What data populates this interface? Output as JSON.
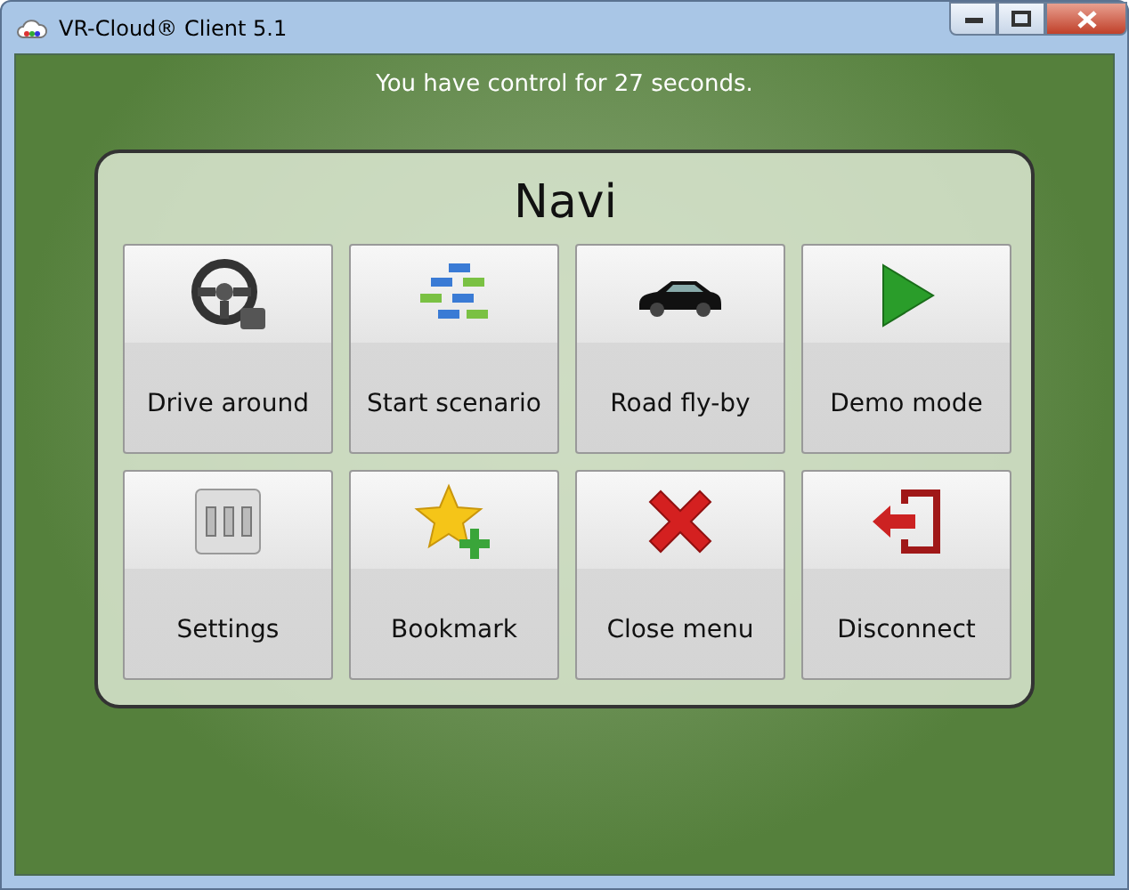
{
  "window": {
    "title": "VR-Cloud® Client 5.1"
  },
  "message": "You have control for 27 seconds.",
  "menu": {
    "title": "Navi",
    "items": [
      {
        "label": "Drive around",
        "kind": "wheel"
      },
      {
        "label": "Start scenario",
        "kind": "flow"
      },
      {
        "label": "Road fly-by",
        "kind": "car"
      },
      {
        "label": "Demo mode",
        "kind": "play"
      },
      {
        "label": "Settings",
        "kind": "panel"
      },
      {
        "label": "Bookmark",
        "kind": "star"
      },
      {
        "label": "Close menu",
        "kind": "cross"
      },
      {
        "label": "Disconnect",
        "kind": "exit"
      }
    ]
  }
}
